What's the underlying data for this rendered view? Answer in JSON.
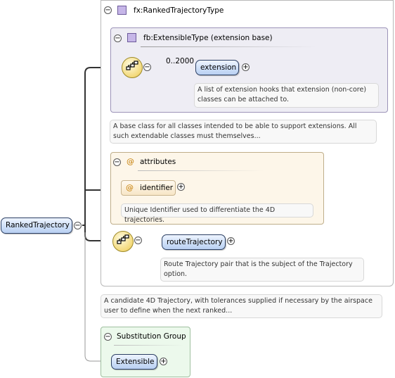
{
  "root": {
    "label": "RankedTrajectory"
  },
  "type_box": {
    "title": "fx:RankedTrajectoryType"
  },
  "base_box": {
    "title": "fb:ExtensibleType (extension base)"
  },
  "extension": {
    "cardinality": "0..2000",
    "label": "extension",
    "doc": "A list of extension hooks that extension (non-core) classes can be attached to."
  },
  "base_doc": "A base class for all classes intended to be able to support extensions. All such extendable classes must themselves...",
  "attributes": {
    "title": "attributes",
    "identifier": "identifier",
    "doc": "Unique Identifier used to differentiate the 4D trajectories."
  },
  "route": {
    "label": "routeTrajectory",
    "doc": "Route Trajectory pair that is the subject of the Trajectory option."
  },
  "root_doc": "A candidate 4D Trajectory, with tolerances supplied if necessary by the airspace user to define when the next ranked...",
  "subst": {
    "title": "Substitution Group",
    "label": "Extensible"
  },
  "icons": {
    "collapse": "minus-circle",
    "expand": "plus-circle",
    "sequence": "sequence-compositor",
    "type": "complex-type-square",
    "attribute": "at-sign"
  }
}
